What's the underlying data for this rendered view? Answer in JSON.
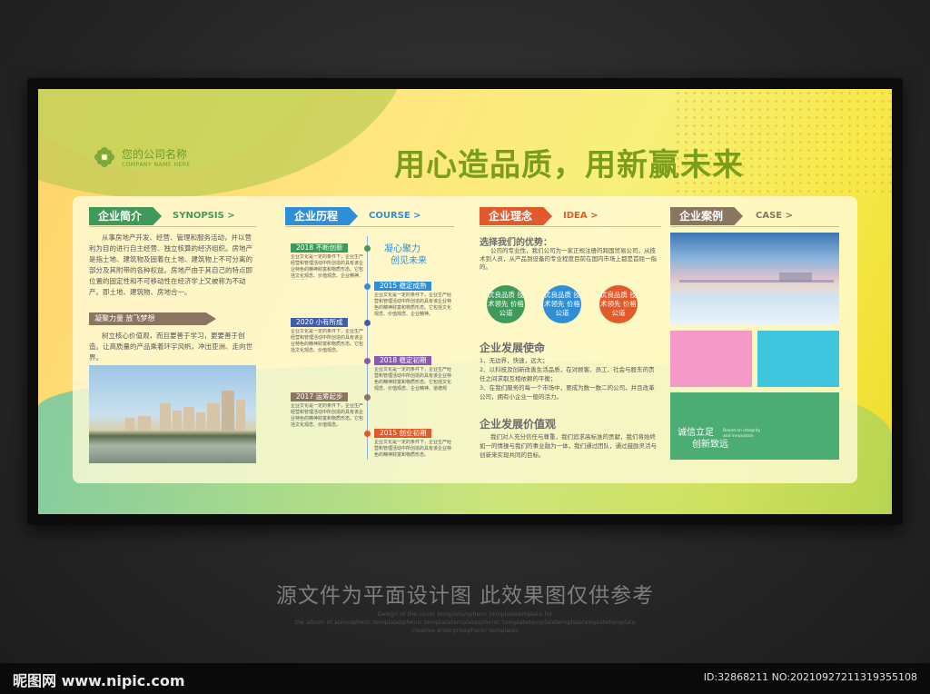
{
  "logo": {
    "name": "您的公司名称",
    "sub": "COMPANY NAME HERE"
  },
  "slogan": "用心造品质，用新赢未来",
  "synopsis": {
    "tag": "企业简介",
    "sub": "SYNOPSIS >",
    "body": "从事房地产开发、经营、管理和服务活动，并以营利为目的进行自主经营、独立核算的经济组织。房地产是指土地、建筑物及固着在土地、建筑物上不可分离的部分及其附带的各种权益。房地产由于其自己的特点即位置的固定性和不可移动性在经济学上又被称为不动产。即土地、建筑物、房地合一。",
    "sub2": "凝聚力量 放飞梦想",
    "body2": "树立核心价值观，而且要善于学习，更要善于创造。让高质量的产品乘着环宇风帆，冲出亚洲、走向世界。"
  },
  "course": {
    "tag": "企业历程",
    "sub": "COURSE >",
    "motto1": "凝心聚力",
    "motto2": "创见未来",
    "items": [
      {
        "label": "2018 不断创新",
        "text": "企业文化是一定的条件下，企业生产经营和管理活动中所创造的具有该企业特色的精神财富和物质形态。它包括文化观念、价值观念、企业精神、道德规范。"
      },
      {
        "label": "2015 稳定成熟",
        "text": "企业文化是一定的条件下，企业生产经营和管理活动中所创造的具有该企业特色的精神财富和物质形态。它包括文化观念、价值观念、企业精神。"
      },
      {
        "label": "2020 小有所成",
        "text": "企业文化是一定的条件下，企业生产经营和管理活动中所创造的具有该企业特色的精神财富和物质形态。它包括文化观念、价值观念。"
      },
      {
        "label": "2018 稳定初期",
        "text": "企业文化是一定的条件下，企业生产经营和管理活动中所创造的具有该企业特色的精神财富和物质形态。它包括文化观念、价值观念、企业精神、道德规范。"
      },
      {
        "label": "2017 运筹起步",
        "text": "企业文化是一定的条件下，企业生产经营和管理活动中所创造的具有该企业特色的精神财富和物质形态。它包括文化观念、价值观念。"
      },
      {
        "label": "2015 创业初期",
        "text": "企业文化是一定的条件下，企业生产经营和管理活动中所创造的具有该企业特色的精神财富和物质形态。"
      }
    ]
  },
  "idea": {
    "tag": "企业理念",
    "sub": "IDEA >",
    "t1": "选择我们的优势：",
    "b1": "公司的专业性，我们公司为一家正规注册的跨国贸易公司，从技术到人员，从产品到设备的专业程度目前在国内市场上都是首屈一指的。",
    "circles": [
      "优良品质 技术领先 价格公道",
      "优良品质 技术领先 价格公道",
      "优良品质 技术领先 价格公道"
    ],
    "t2": "企业发展使命",
    "m1": "1、无边界，快速，远大；",
    "m2": "2、以科技及创新改善生活品质，在对顾客、员工、社会与股东的责任之间求取互相依赖的平衡；",
    "m3": "3、在我们服务的每一个市场中，要成为数一数二的公司，并且改革公司，拥有小企业一般的活力。",
    "t3": "企业发展价值观",
    "v1": "我们对人充分信任与尊重，我们追求高标准的贡献，我们将始终如一的情操与我们的事业融为一体，我们通过团队，通过鼓励灵活与创新来实现共同的目标。"
  },
  "case": {
    "tag": "企业案例",
    "sub": "CASE >",
    "slogan1": "诚信立足",
    "slogan2": "创新致远",
    "en1": "Based on integrity",
    "en2": "and innovation"
  },
  "colors": {
    "green": "#3f9a5a",
    "blue": "#2f8fd6",
    "orange": "#e25a2b",
    "brown": "#8a7560",
    "pink": "#f59ac8",
    "cyan": "#3fc5de",
    "case_green": "#4bad73"
  },
  "footer": {
    "main": "源文件为平面设计图 此效果图仅供参考",
    "l1": "Design of the cover template/spheric templatetemplate for",
    "l2": "the album of atmospheric templatesphenic templatetemplatesphenic templatetemplatetemplatetemplatetemplate",
    "l3": "creative enterprisephenic templates"
  },
  "site": "昵图网 www.nipic.com",
  "id": "ID:32868211 NO:20210927211319355108"
}
